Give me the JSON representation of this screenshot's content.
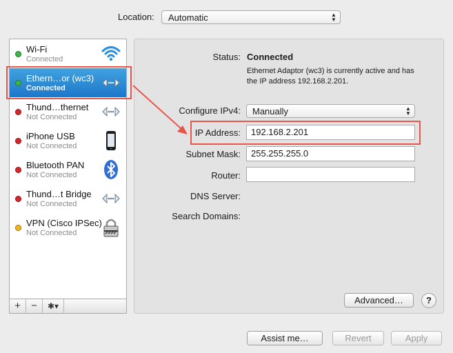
{
  "location": {
    "label": "Location:",
    "value": "Automatic"
  },
  "services": [
    {
      "name": "Wi-Fi",
      "status": "Connected",
      "dot": "#3cb54a",
      "icon": "wifi-icon"
    },
    {
      "name": "Ethern…or (wc3)",
      "status": "Connected",
      "dot": "#3cb54a",
      "icon": "ethernet-arrows-icon",
      "selected": true
    },
    {
      "name": "Thund…thernet",
      "status": "Not Connected",
      "dot": "#d8262a",
      "icon": "ethernet-arrows-icon"
    },
    {
      "name": "iPhone USB",
      "status": "Not Connected",
      "dot": "#d8262a",
      "icon": "iphone-icon"
    },
    {
      "name": "Bluetooth PAN",
      "status": "Not Connected",
      "dot": "#d8262a",
      "icon": "bluetooth-icon"
    },
    {
      "name": "Thund…t Bridge",
      "status": "Not Connected",
      "dot": "#d8262a",
      "icon": "ethernet-arrows-icon"
    },
    {
      "name": "VPN (Cisco IPSec)",
      "status": "Not Connected",
      "dot": "#f2b51c",
      "icon": "vpn-lock-icon"
    }
  ],
  "sidebar_controls": {
    "add": "+",
    "remove": "−",
    "gear": "✱▾"
  },
  "detail": {
    "status_label": "Status:",
    "status_value": "Connected",
    "status_description": "Ethernet Adaptor (wc3) is currently active and has the IP address 192.168.2.201.",
    "configure_label": "Configure IPv4:",
    "configure_value": "Manually",
    "ip_label": "IP Address:",
    "ip_value": "192.168.2.201",
    "subnet_label": "Subnet Mask:",
    "subnet_value": "255.255.255.0",
    "router_label": "Router:",
    "router_value": "",
    "dns_label": "DNS Server:",
    "search_label": "Search Domains:",
    "advanced_label": "Advanced…",
    "help_label": "?"
  },
  "footer": {
    "assist_label": "Assist me…",
    "revert_label": "Revert",
    "apply_label": "Apply"
  },
  "colors": {
    "annotation": "#e8544a",
    "selection": "#1d78c9"
  }
}
